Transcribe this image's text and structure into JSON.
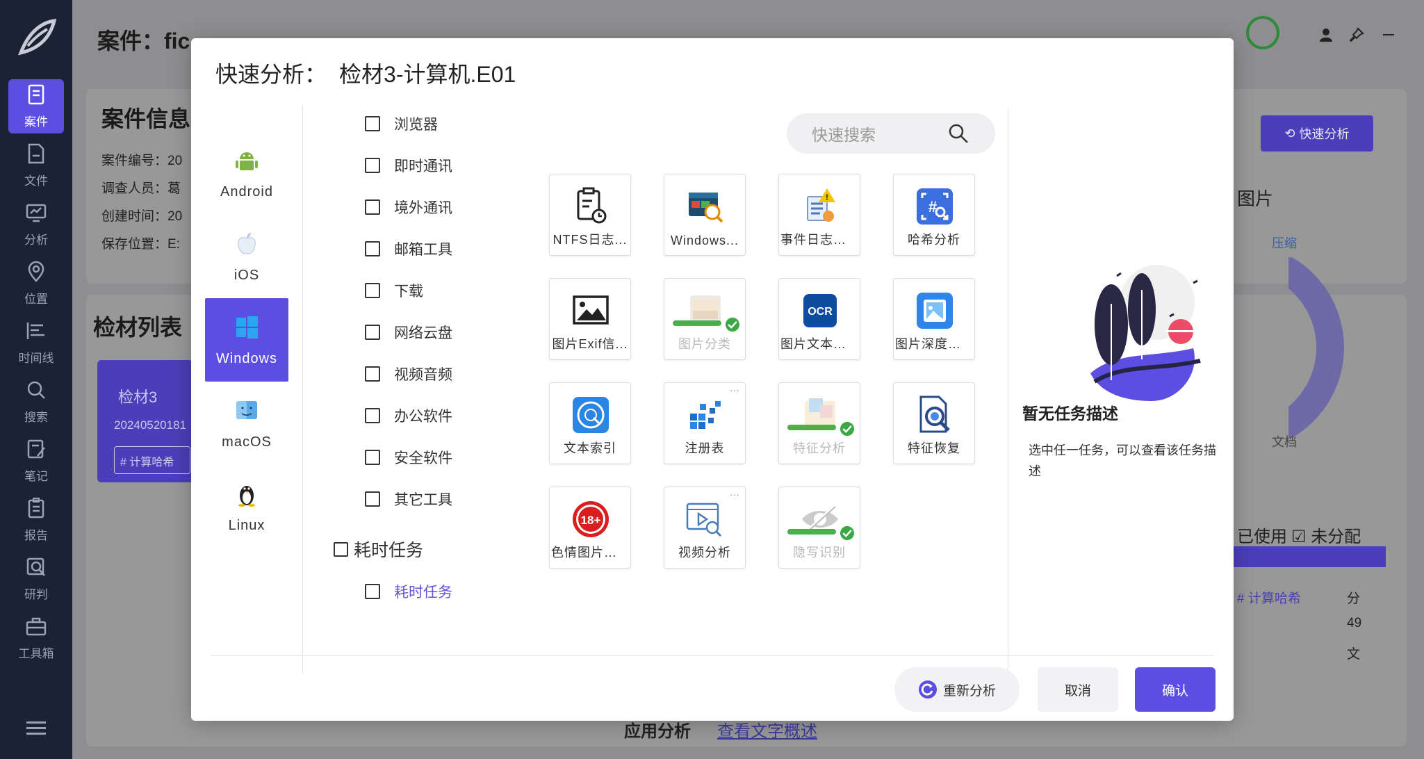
{
  "app": {
    "sidebar": [
      {
        "label": "案件",
        "icon": "case-icon",
        "active": true
      },
      {
        "label": "文件",
        "icon": "file-icon"
      },
      {
        "label": "分析",
        "icon": "analysis-icon"
      },
      {
        "label": "位置",
        "icon": "location-icon"
      },
      {
        "label": "时间线",
        "icon": "timeline-icon"
      },
      {
        "label": "搜索",
        "icon": "search-icon"
      },
      {
        "label": "笔记",
        "icon": "note-icon"
      },
      {
        "label": "报告",
        "icon": "report-icon"
      },
      {
        "label": "研判",
        "icon": "research-icon"
      },
      {
        "label": "工具箱",
        "icon": "toolbox-icon"
      }
    ],
    "case_title": "案件：fic",
    "case_info_heading": "案件信息",
    "case_fields": [
      "案件编号：20",
      "调查人员：葛",
      "创建时间：20",
      "保存位置：E:"
    ],
    "evidence_heading": "检材列表",
    "evidence_card": {
      "name": "检材3",
      "date": "20240520181",
      "hash_btn": "# 计算哈希"
    },
    "quick_analysis_btn": "快速分析",
    "chart_labels": {
      "compress": "压缩",
      "doc": "文档",
      "image_partial": "图片"
    },
    "filters": {
      "used": "已使用",
      "unassigned": "未分配"
    },
    "table_partial": {
      "hash": "# 计算哈希",
      "col1": "分",
      "col2": "49",
      "col3": "文"
    },
    "app_analysis": "应用分析",
    "view_text": "查看文字概述"
  },
  "dialog": {
    "title_prefix": "快速分析：",
    "title_file": "检材3-计算机.E01",
    "os": [
      {
        "label": "Android",
        "icon": "android-icon"
      },
      {
        "label": "iOS",
        "icon": "apple-icon"
      },
      {
        "label": "Windows",
        "icon": "windows-icon",
        "active": true
      },
      {
        "label": "macOS",
        "icon": "macos-icon"
      },
      {
        "label": "Linux",
        "icon": "linux-icon"
      }
    ],
    "categories": [
      "浏览器",
      "即时通讯",
      "境外通讯",
      "邮箱工具",
      "下载",
      "网络云盘",
      "视频音频",
      "办公软件",
      "安全软件",
      "其它工具"
    ],
    "group": {
      "label": "耗时任务",
      "child": "耗时任务"
    },
    "search_placeholder": "快速搜索",
    "tools": [
      {
        "label": "NTFS日志...",
        "icon": "ntfs-log-icon"
      },
      {
        "label": "Windows...",
        "icon": "windows-tool-icon"
      },
      {
        "label": "事件日志恢...",
        "icon": "event-log-icon"
      },
      {
        "label": "哈希分析",
        "icon": "hash-icon"
      },
      {
        "label": "图片Exif信...",
        "icon": "image-exif-icon"
      },
      {
        "label": "图片分类",
        "icon": "image-classify-icon",
        "disabled": true,
        "done": true
      },
      {
        "label": "图片文本识...",
        "icon": "ocr-icon"
      },
      {
        "label": "图片深度恢...",
        "icon": "image-recover-icon"
      },
      {
        "label": "文本索引",
        "icon": "text-index-icon"
      },
      {
        "label": "注册表",
        "icon": "registry-icon",
        "more": true
      },
      {
        "label": "特征分析",
        "icon": "feature-analysis-icon",
        "disabled": true,
        "done": true
      },
      {
        "label": "特征恢复",
        "icon": "feature-recover-icon"
      },
      {
        "label": "色情图片文...",
        "icon": "adult-content-icon"
      },
      {
        "label": "视频分析",
        "icon": "video-analysis-icon",
        "more": true
      },
      {
        "label": "隐写识别",
        "icon": "steganography-icon",
        "disabled": true,
        "done": true
      }
    ],
    "desc_title": "暂无任务描述",
    "desc_text": "选中任一任务，可以查看该任务描述",
    "buttons": {
      "reanalyze": "重新分析",
      "cancel": "取消",
      "confirm": "确认"
    },
    "ocr_text": "OCR",
    "adult_text": "18+"
  },
  "colors": {
    "accent": "#5b4ee0",
    "success": "#39a845",
    "sidebar_bg": "#1b2233"
  }
}
